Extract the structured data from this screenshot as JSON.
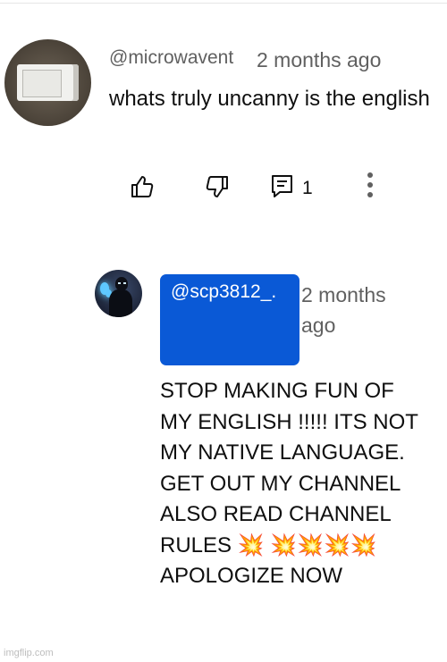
{
  "comment": {
    "username": "@microwavent",
    "time": "2 months ago",
    "text": "whats truly uncanny is the english",
    "reply_count": "1"
  },
  "reply": {
    "username": "@scp3812_.",
    "time": "2 months ago",
    "text": "STOP MAKING FUN OF MY ENGLISH !!!!! ITS NOT MY NATIVE LANGUAGE.  GET OUT MY CHANNEL ALSO READ CHANNEL RULES 💥 💥💥💥💥 APOLOGIZE NOW"
  },
  "icons": [
    "like-icon",
    "dislike-icon",
    "reply-icon",
    "more-icon"
  ],
  "watermark": "imgflip.com"
}
